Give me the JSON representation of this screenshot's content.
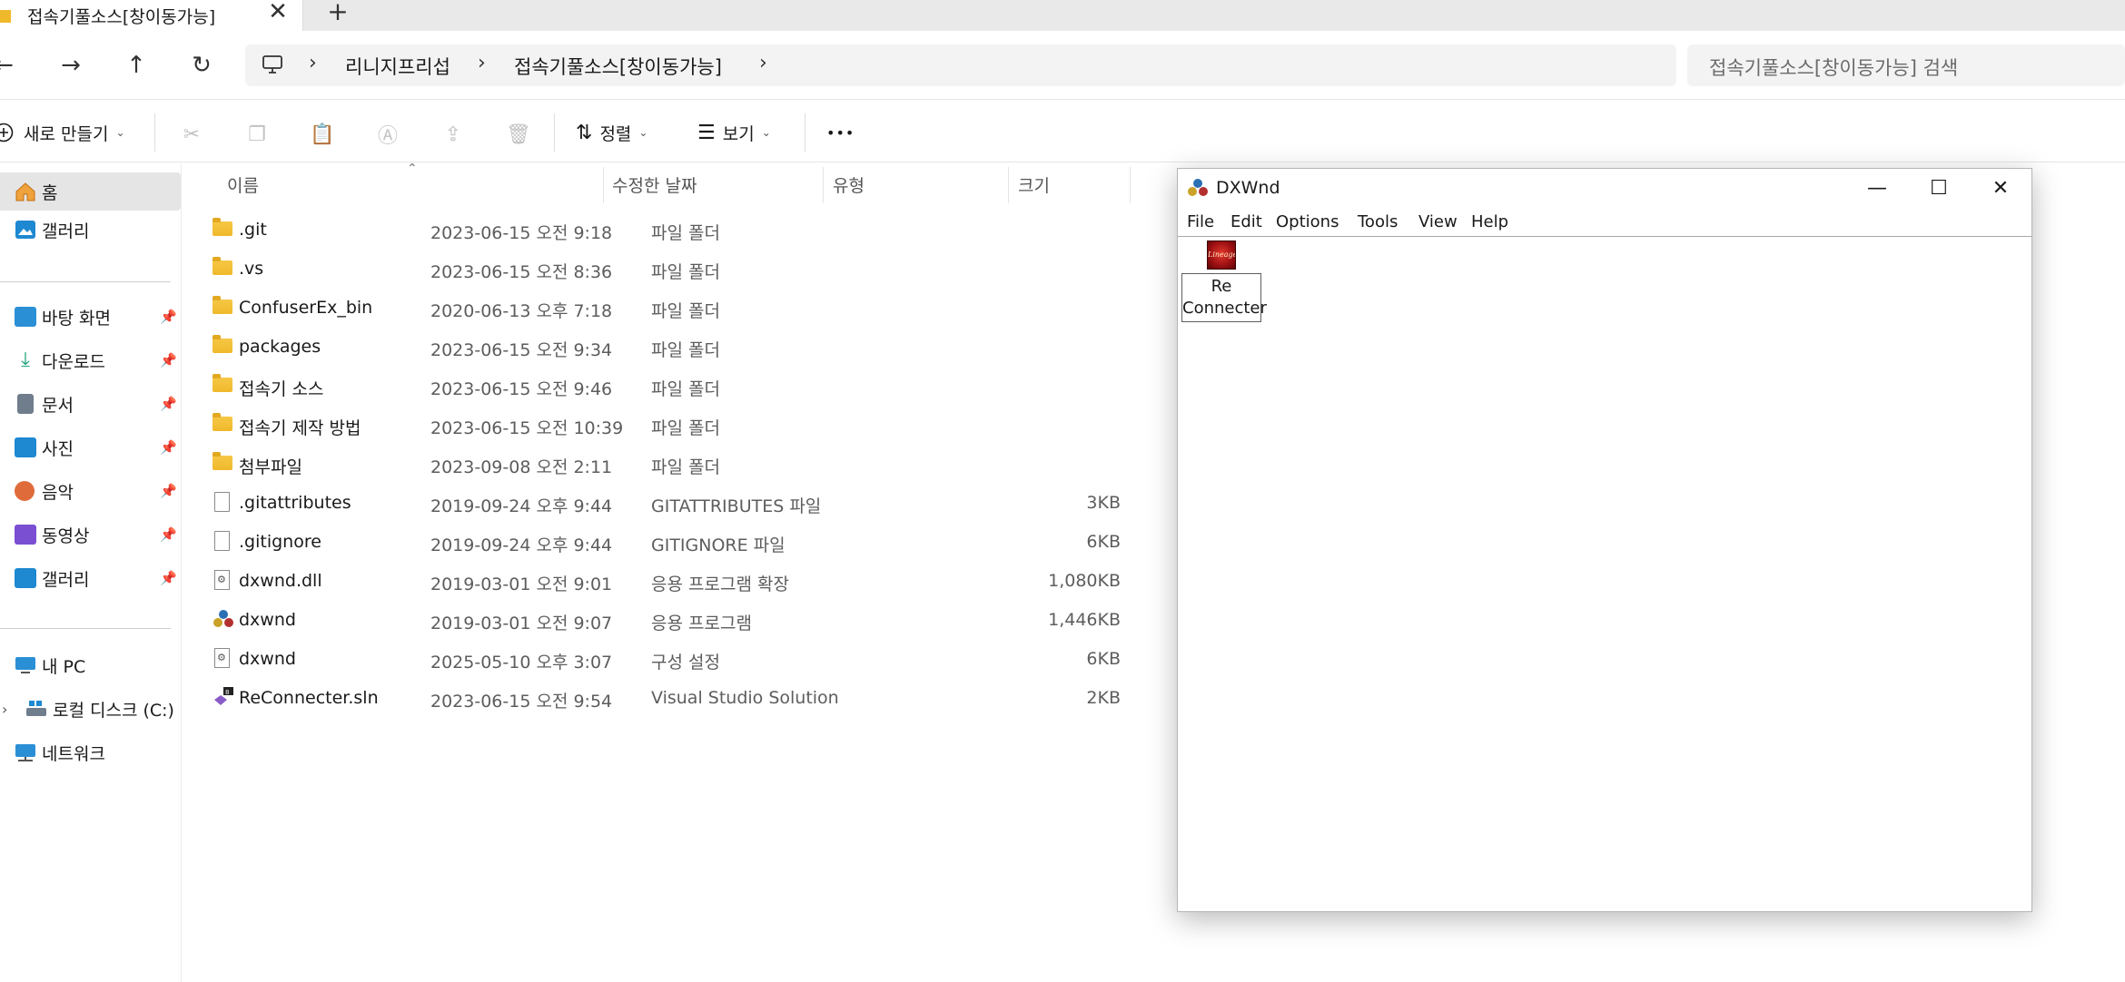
{
  "tab": {
    "title": "접속기풀소스[창이동가능]",
    "close_glyph": "✕",
    "new_glyph": "+"
  },
  "nav": {
    "back": "←",
    "forward": "→",
    "up": "↑",
    "refresh": "↻"
  },
  "breadcrumb": {
    "sep": "›",
    "items": [
      "리니지프리섭",
      "접속기풀소스[창이동가능]"
    ]
  },
  "search": {
    "placeholder": "접속기풀소스[창이동가능] 검색"
  },
  "commands": {
    "new_label": "새로 만들기",
    "sort_label": "정렬",
    "view_label": "보기",
    "more": "•••"
  },
  "sidebar": {
    "home": "홈",
    "gallery": "갤러리",
    "pinned": [
      {
        "label": "바탕 화면",
        "icon": "desktop-icon",
        "color": "#2b8fd6"
      },
      {
        "label": "다운로드",
        "icon": "download-icon",
        "color": "#1aa37a"
      },
      {
        "label": "문서",
        "icon": "documents-icon",
        "color": "#6f7d8c"
      },
      {
        "label": "사진",
        "icon": "pictures-icon",
        "color": "#1e88d1"
      },
      {
        "label": "음악",
        "icon": "music-icon",
        "color": "#e06b3a"
      },
      {
        "label": "동영상",
        "icon": "videos-icon",
        "color": "#7b4fd1"
      },
      {
        "label": "갤러리",
        "icon": "gallery-icon",
        "color": "#1e88d1"
      }
    ],
    "this_pc": "내 PC",
    "local_disk": "로컬 디스크 (C:)",
    "network": "네트워크"
  },
  "columns": {
    "name": "이름",
    "modified": "수정한 날짜",
    "type": "유형",
    "size": "크기"
  },
  "files": [
    {
      "name": ".git",
      "modified": "2023-06-15 오전 9:18",
      "type": "파일 폴더",
      "size": "",
      "icon": "folder"
    },
    {
      "name": ".vs",
      "modified": "2023-06-15 오전 8:36",
      "type": "파일 폴더",
      "size": "",
      "icon": "folder"
    },
    {
      "name": "ConfuserEx_bin",
      "modified": "2020-06-13 오후 7:18",
      "type": "파일 폴더",
      "size": "",
      "icon": "folder"
    },
    {
      "name": "packages",
      "modified": "2023-06-15 오전 9:34",
      "type": "파일 폴더",
      "size": "",
      "icon": "folder"
    },
    {
      "name": "접속기 소스",
      "modified": "2023-06-15 오전 9:46",
      "type": "파일 폴더",
      "size": "",
      "icon": "folder"
    },
    {
      "name": "접속기 제작 방법",
      "modified": "2023-06-15 오전 10:39",
      "type": "파일 폴더",
      "size": "",
      "icon": "folder"
    },
    {
      "name": "첨부파일",
      "modified": "2023-09-08 오전 2:11",
      "type": "파일 폴더",
      "size": "",
      "icon": "folder"
    },
    {
      "name": ".gitattributes",
      "modified": "2019-09-24 오후 9:44",
      "type": "GITATTRIBUTES 파일",
      "size": "3KB",
      "icon": "file"
    },
    {
      "name": ".gitignore",
      "modified": "2019-09-24 오후 9:44",
      "type": "GITIGNORE 파일",
      "size": "6KB",
      "icon": "file"
    },
    {
      "name": "dxwnd.dll",
      "modified": "2019-03-01 오전 9:01",
      "type": "응용 프로그램 확장",
      "size": "1,080KB",
      "icon": "dll"
    },
    {
      "name": "dxwnd",
      "modified": "2019-03-01 오전 9:07",
      "type": "응용 프로그램",
      "size": "1,446KB",
      "icon": "app"
    },
    {
      "name": "dxwnd",
      "modified": "2025-05-10 오후 3:07",
      "type": "구성 설정",
      "size": "6KB",
      "icon": "dll"
    },
    {
      "name": "ReConnecter.sln",
      "modified": "2023-06-15 오전 9:54",
      "type": "Visual Studio Solution",
      "size": "2KB",
      "icon": "sln"
    }
  ],
  "dxwnd": {
    "title": "DXWnd",
    "minimize": "—",
    "maximize": "☐",
    "close": "✕",
    "menu": [
      "File",
      "Edit",
      "Options",
      "Tools",
      "View",
      "Help"
    ],
    "entry": {
      "line1": "Re",
      "line2": "Connecter",
      "icon_text": "Lineage"
    }
  },
  "colors": {
    "folder": "#f0b92b",
    "selection": "#e5e5e5",
    "accent": "#0067c0"
  }
}
